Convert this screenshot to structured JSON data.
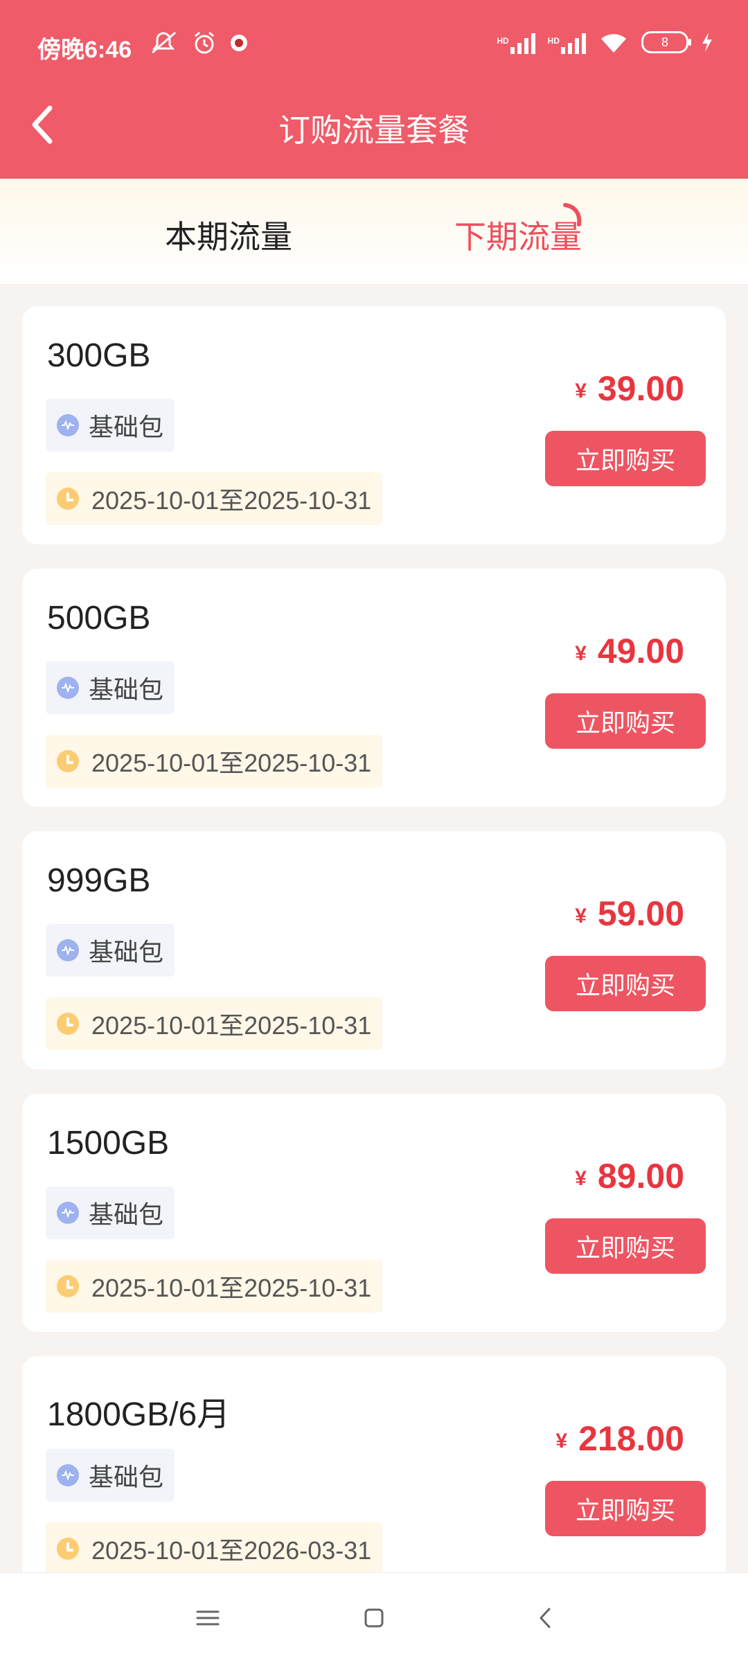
{
  "status_bar": {
    "time": "傍晚6:46",
    "network_hd_1": "HD",
    "network_hd_2": "HD",
    "battery": "8",
    "icons": [
      "mute-icon",
      "alarm-icon",
      "app-notification-icon",
      "signal-icon",
      "signal-icon",
      "wifi-icon",
      "battery-icon",
      "charging-icon"
    ]
  },
  "header": {
    "title": "订购流量套餐",
    "back_icon": "chevron-left-icon",
    "colors": {
      "bar": "#ef5b68",
      "accent": "#e8353f",
      "button": "#ee5562"
    }
  },
  "tabs": {
    "current": "本期流量",
    "next": "下期流量",
    "selected": "下期流量"
  },
  "packages": [
    {
      "name": "300GB",
      "type": "基础包",
      "period": "2025-10-01至2025-10-31",
      "currency": "¥",
      "price": "39.00",
      "button": "立即购买"
    },
    {
      "name": "500GB",
      "type": "基础包",
      "period": "2025-10-01至2025-10-31",
      "currency": "¥",
      "price": "49.00",
      "button": "立即购买"
    },
    {
      "name": "999GB",
      "type": "基础包",
      "period": "2025-10-01至2025-10-31",
      "currency": "¥",
      "price": "59.00",
      "button": "立即购买"
    },
    {
      "name": "1500GB",
      "type": "基础包",
      "period": "2025-10-01至2025-10-31",
      "currency": "¥",
      "price": "89.00",
      "button": "立即购买"
    },
    {
      "name": "1800GB/6月",
      "type": "基础包",
      "period": "2025-10-01至2026-03-31",
      "currency": "¥",
      "price": "218.00",
      "button": "立即购买"
    }
  ],
  "nav": {
    "icons": [
      "menu-icon",
      "home-icon",
      "back-icon"
    ]
  }
}
